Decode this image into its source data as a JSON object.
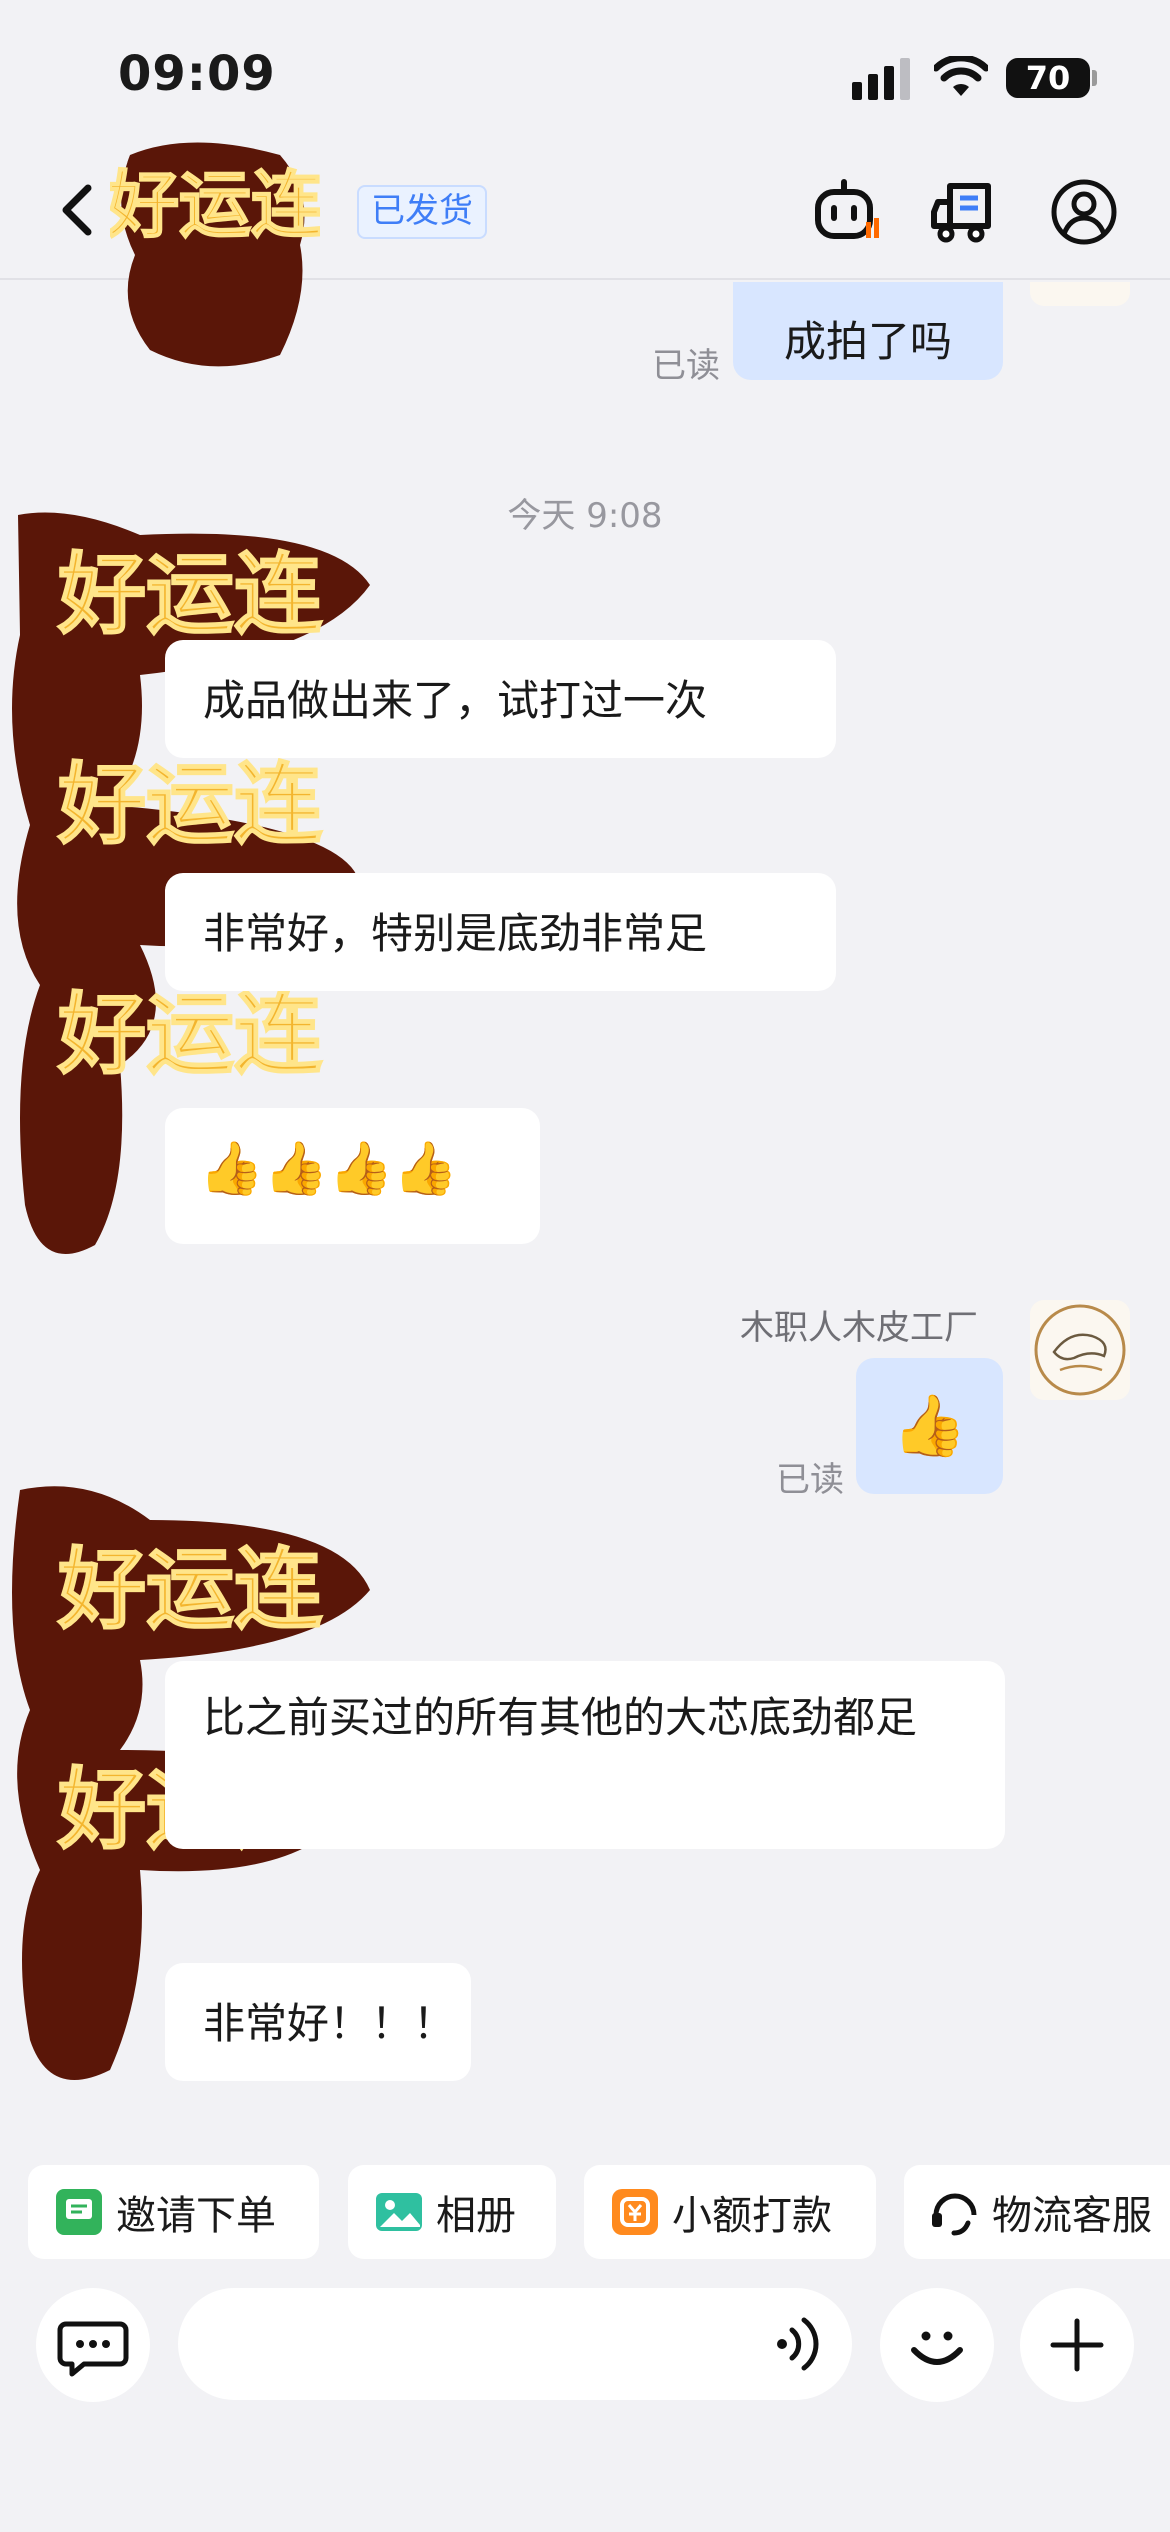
{
  "status_bar": {
    "time": "09:09",
    "battery": "70"
  },
  "header": {
    "shop_name": "好运连",
    "order_status": "已发货"
  },
  "chat": {
    "divider_time": "今天 9:08",
    "messages": [
      {
        "side": "out",
        "text": "成拍了吗",
        "receipt": "已读"
      },
      {
        "side": "in",
        "text": "成品做出来了，试打过一次"
      },
      {
        "side": "in",
        "text": "非常好，特别是底劲非常足"
      },
      {
        "side": "in",
        "text": "👍👍👍👍"
      },
      {
        "side": "out",
        "sender": "木职人木皮工厂",
        "text": "👍",
        "receipt": "已读"
      },
      {
        "side": "in",
        "text": "比之前买过的所有其他的大芯底劲都足"
      },
      {
        "side": "in",
        "text": "非常好！！！"
      }
    ],
    "sticker_text": "好运连"
  },
  "quick_actions": [
    {
      "label": "邀请下单",
      "icon": "order-invite-icon"
    },
    {
      "label": "相册",
      "icon": "album-icon"
    },
    {
      "label": "小额打款",
      "icon": "payment-icon"
    },
    {
      "label": "物流客服",
      "icon": "logistics-service-icon"
    }
  ],
  "input": {
    "placeholder": ""
  },
  "colors": {
    "accent": "#3f7ef7",
    "outgoing_bubble": "#d8e6ff",
    "background": "#f2f2f5"
  }
}
